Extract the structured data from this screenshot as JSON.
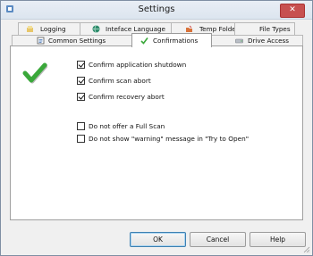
{
  "window": {
    "title": "Settings",
    "close_glyph": "✕"
  },
  "tabs_back": [
    {
      "label": "Logging",
      "icon": "logging-icon"
    },
    {
      "label": "Inteface Language",
      "icon": "globe-icon"
    },
    {
      "label": "Temp Folder",
      "icon": "temp-folder-icon"
    },
    {
      "label": "File Types"
    }
  ],
  "tabs_front": [
    {
      "label": "Common Settings",
      "icon": "common-settings-icon"
    },
    {
      "label": "Confirmations",
      "icon": "checkmark-icon",
      "active": true
    },
    {
      "label": "Drive Access",
      "icon": "drive-icon"
    }
  ],
  "options": [
    {
      "label": "Confirm application shutdown",
      "checked": true
    },
    {
      "label": "Confirm scan abort",
      "checked": true
    },
    {
      "label": "Confirm recovery abort",
      "checked": true
    },
    {
      "label": "Do not offer a Full Scan",
      "checked": false
    },
    {
      "label": "Do not show \"warning\" message  in \"Try to Open\"",
      "checked": false
    }
  ],
  "buttons": {
    "ok": "OK",
    "cancel": "Cancel",
    "help": "Help"
  },
  "colors": {
    "accent_green": "#3aa83a",
    "close_red": "#c75050"
  }
}
